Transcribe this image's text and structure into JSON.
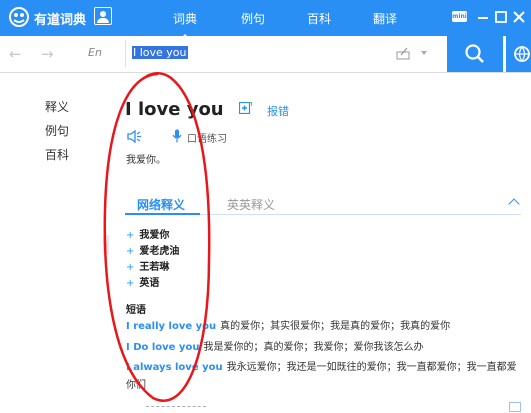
{
  "app": {
    "title": "有道词典"
  },
  "tabs": [
    {
      "label": "词典",
      "active": true
    },
    {
      "label": "例句",
      "active": false
    },
    {
      "label": "百科",
      "active": false
    },
    {
      "label": "翻译",
      "active": false
    }
  ],
  "window": {
    "mini_label": "mini"
  },
  "search": {
    "lang": "En",
    "query": "I love you"
  },
  "sidebar": {
    "items": [
      {
        "label": "释义"
      },
      {
        "label": "例句"
      },
      {
        "label": "百科"
      }
    ]
  },
  "entry": {
    "word": "I love you",
    "edit_label": "报错",
    "practice_label": "口语练习",
    "meaning": "我爱你。"
  },
  "sections": {
    "web_tab": "网络释义",
    "en_tab": "英英释义"
  },
  "web_items": [
    "我爱你",
    "爱老虎油",
    "王若琳",
    "英语"
  ],
  "phrases": {
    "header": "短语",
    "items": [
      {
        "en": "I really love you",
        "zh": "真的爱你；其实很爱你；我是真的爱你；我真的爱你"
      },
      {
        "en": "I Do love you",
        "zh": "我是爱你的；真的爱你；我爱你；爱你我该怎么办"
      },
      {
        "en": "I always love you",
        "zh": "我永远爱你；我还是一如既往的爱你；我一直都爱你；我一直都爱你们"
      }
    ]
  },
  "colors": {
    "brand": "#2a8ff5",
    "highlight": "#3374e0",
    "annotation": "#e8171b"
  }
}
